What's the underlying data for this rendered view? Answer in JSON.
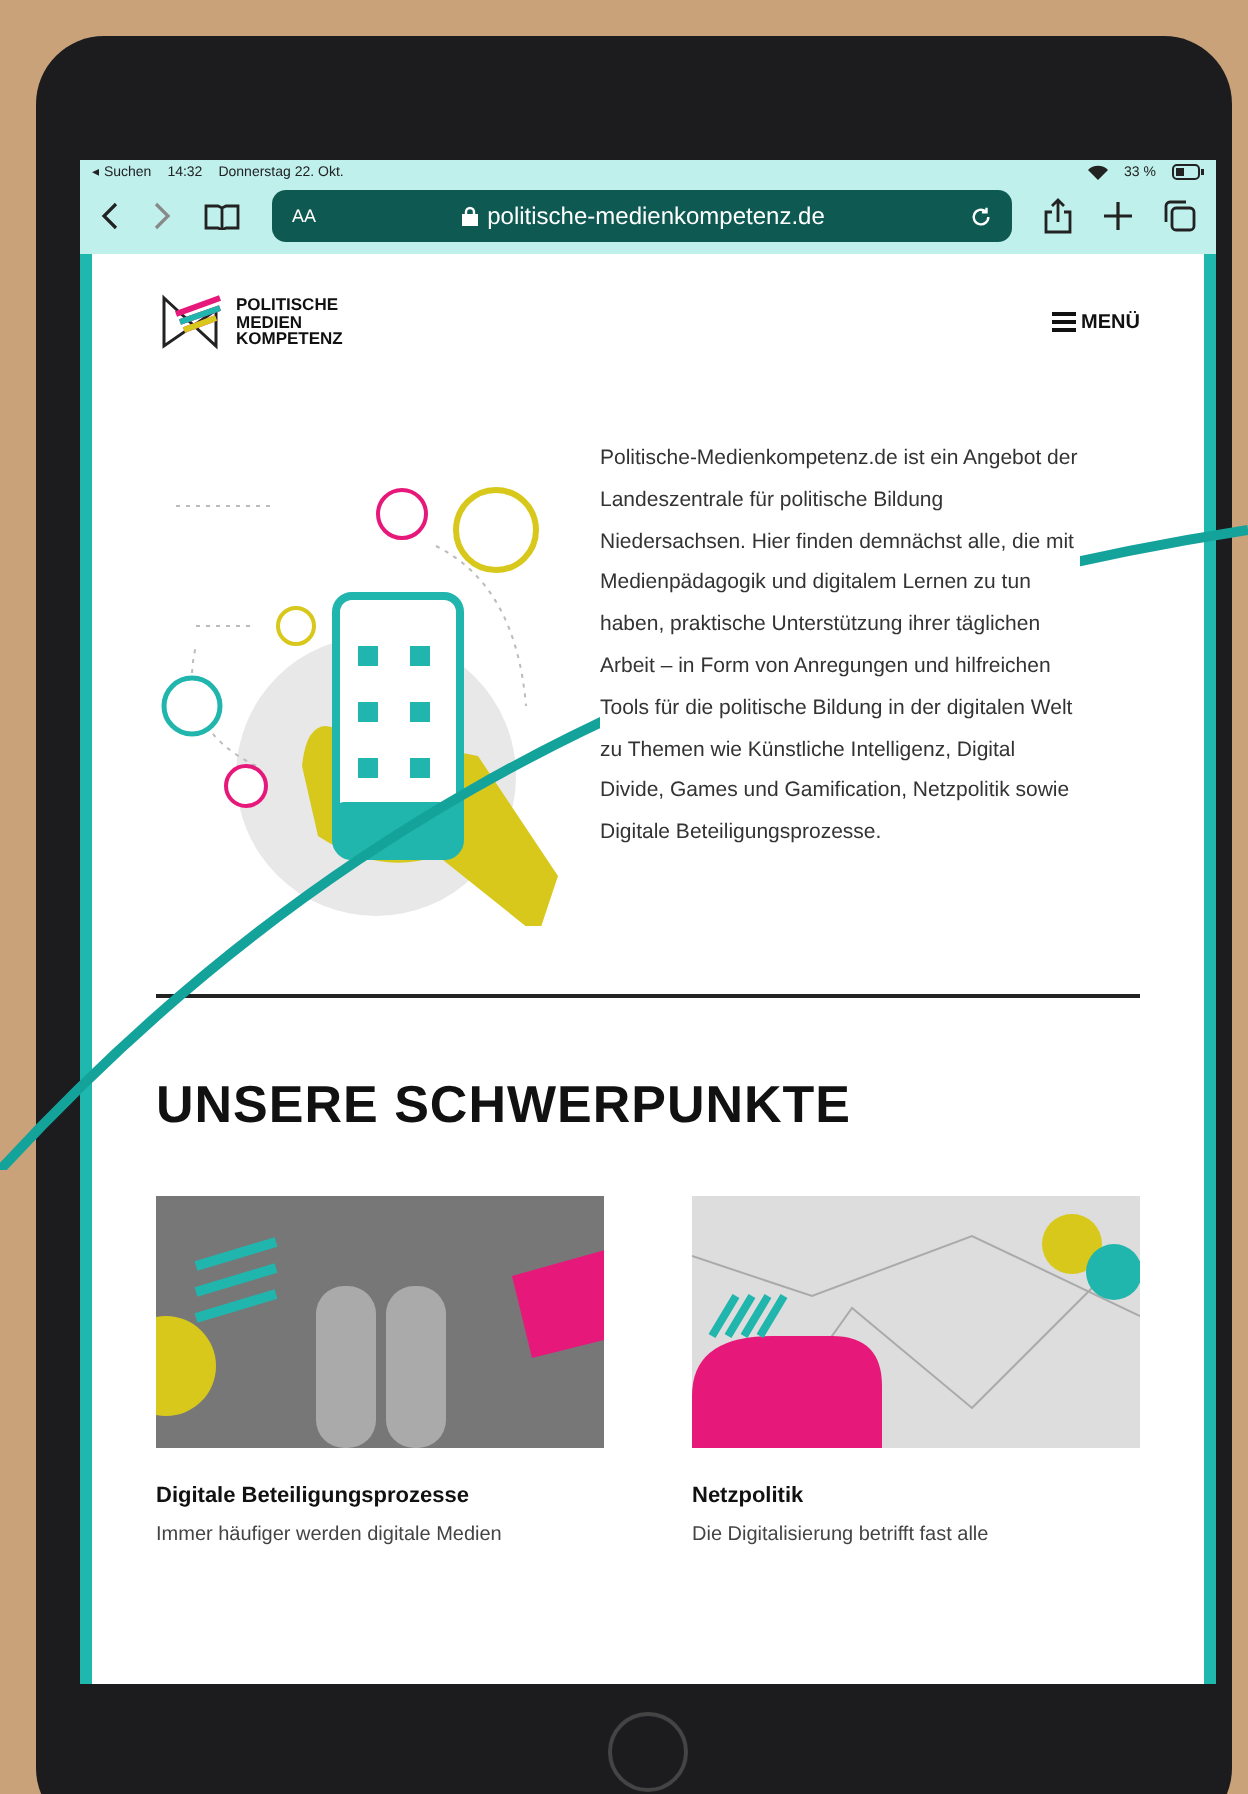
{
  "status_bar": {
    "back_app": "◂ Suchen",
    "time": "14:32",
    "date": "Donnerstag 22. Okt.",
    "battery": "33 %"
  },
  "browser": {
    "text_size": "AA",
    "url": "politische-medienkompetenz.de"
  },
  "site": {
    "logo_lines": [
      "POLITISCHE",
      "MEDIEN",
      "KOMPETENZ"
    ],
    "menu": "MENÜ",
    "intro": "Politische-Medienkompetenz.de ist ein Angebot der Landeszentrale für politische Bildung Niedersachsen. Hier finden demnächst alle, die mit Medienpädagogik und digitalem Lernen zu tun haben, praktische Unterstützung ihrer täglichen Arbeit – in Form von Anregungen und hilfreichen Tools für die politische Bildung in der digitalen Welt zu Themen wie Künstliche Intelligenz, Digital Divide, Games und Gamification, Netzpolitik sowie Digitale Beteiligungsprozesse.",
    "section_title": "UNSERE SCHWERPUNKTE",
    "cards": [
      {
        "kind": "shoes",
        "title": "Digitale Beteiligungsprozesse",
        "text": "Immer häufiger werden digitale Medien"
      },
      {
        "kind": "network",
        "title": "Netzpolitik",
        "text": "Die Digitalisierung betrifft fast alle"
      }
    ]
  }
}
